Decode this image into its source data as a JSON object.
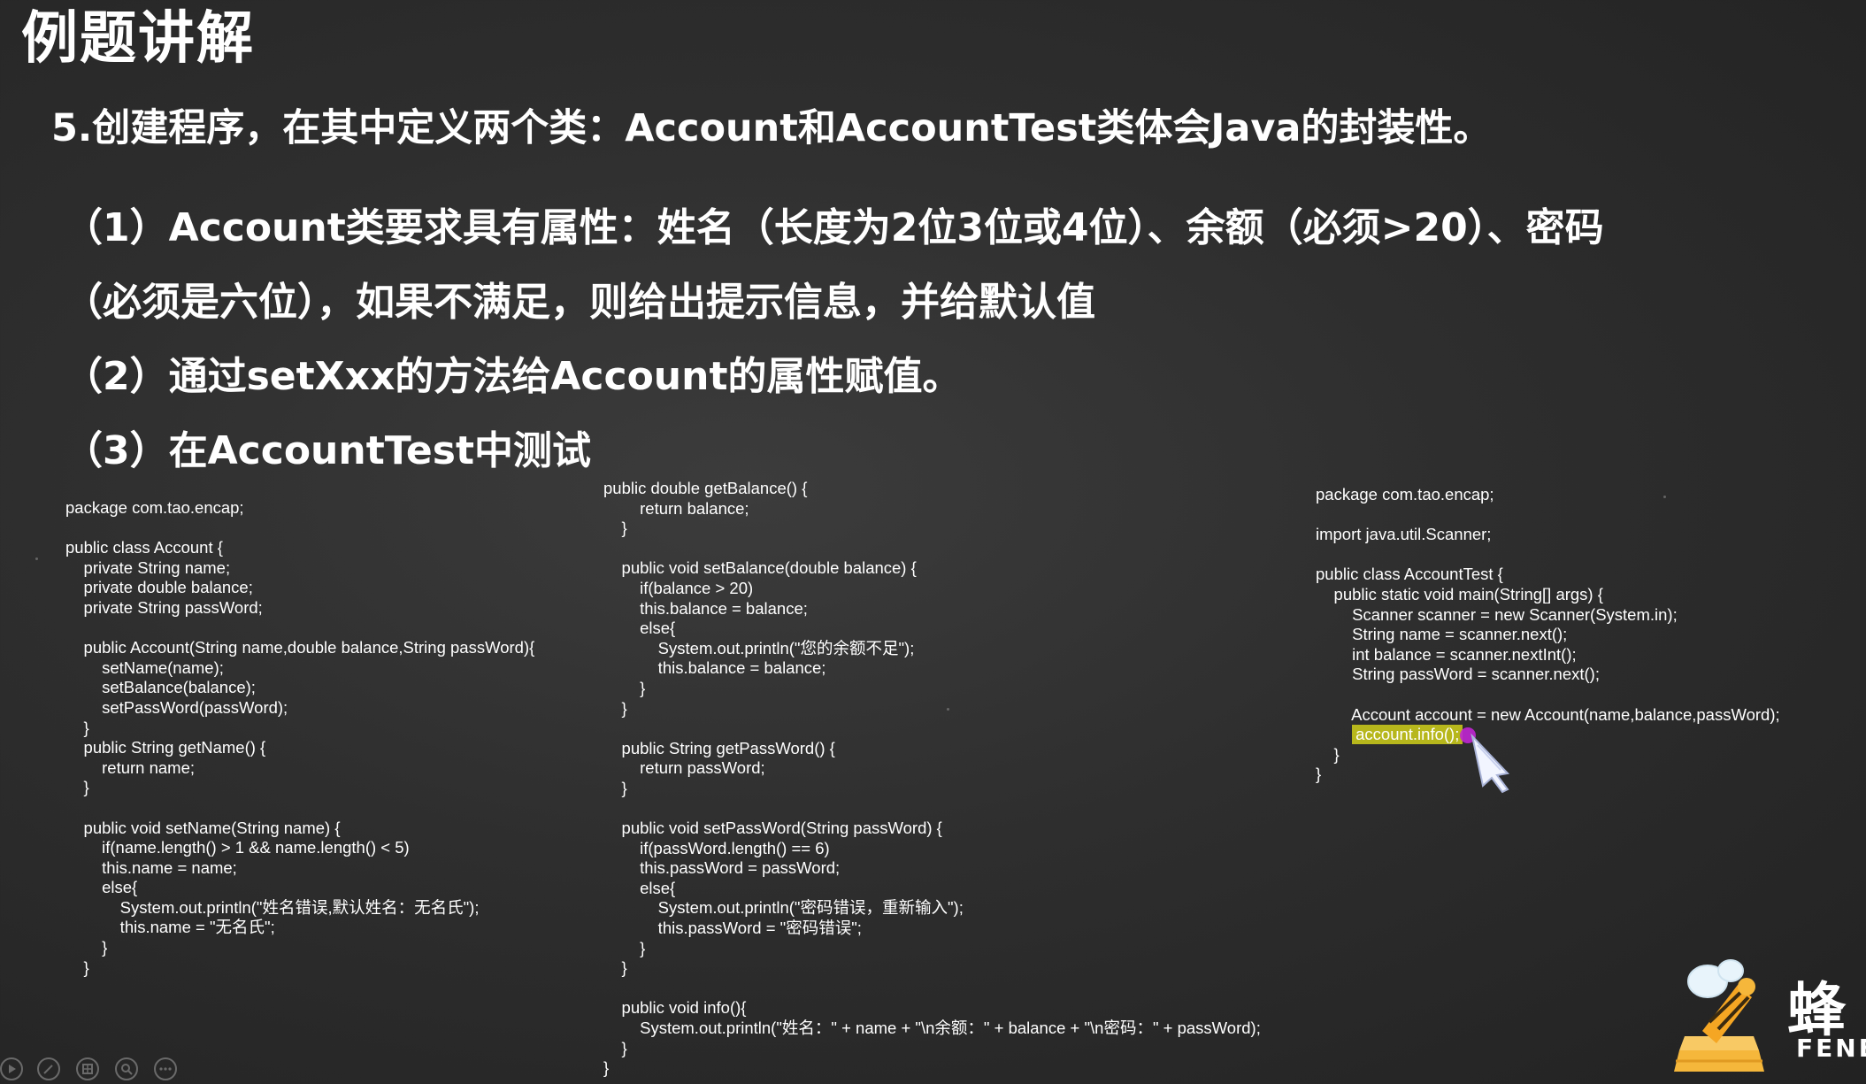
{
  "slide": {
    "title": "例题讲解",
    "question": "5.创建程序，在其中定义两个类：Account和AccountTest类体会Java的封装性。",
    "requirements": [
      "（1）Account类要求具有属性：姓名（长度为2位3位或4位）、余额（必须>20）、密码",
      "（必须是六位），如果不满足，则给出提示信息，并给默认值",
      "（2）通过setXxx的方法给Account的属性赋值。",
      "（3）在AccountTest中测试"
    ]
  },
  "code": {
    "left": [
      "package com.tao.encap;",
      "",
      "public class Account {",
      "    private String name;",
      "    private double balance;",
      "    private String passWord;",
      "",
      "    public Account(String name,double balance,String passWord){",
      "        setName(name);",
      "        setBalance(balance);",
      "        setPassWord(passWord);",
      "    }",
      "    public String getName() {",
      "        return name;",
      "    }",
      "",
      "    public void setName(String name) {",
      "        if(name.length() > 1 && name.length() < 5)",
      "        this.name = name;",
      "        else{",
      "            System.out.println(\"姓名错误,默认姓名：无名氏\");",
      "            this.name = \"无名氏\";",
      "        }",
      "    }"
    ],
    "middle": [
      "public double getBalance() {",
      "        return balance;",
      "    }",
      "",
      "    public void setBalance(double balance) {",
      "        if(balance > 20)",
      "        this.balance = balance;",
      "        else{",
      "            System.out.println(\"您的余额不足\");",
      "            this.balance = balance;",
      "        }",
      "    }",
      "",
      "    public String getPassWord() {",
      "        return passWord;",
      "    }",
      "",
      "    public void setPassWord(String passWord) {",
      "        if(passWord.length() == 6)",
      "        this.passWord = passWord;",
      "        else{",
      "            System.out.println(\"密码错误，重新输入\");",
      "            this.passWord = \"密码错误\";",
      "        }",
      "    }",
      "",
      "    public void info(){",
      "        System.out.println(\"姓名：\" + name + \"\\n余额：\" + balance + \"\\n密码：\" + passWord);",
      "    }",
      "}"
    ],
    "right": [
      "package com.tao.encap;",
      "",
      "import java.util.Scanner;",
      "",
      "public class AccountTest {",
      "    public static void main(String[] args) {",
      "        Scanner scanner = new Scanner(System.in);",
      "        String name = scanner.next();",
      "        int balance = scanner.nextInt();",
      "        String passWord = scanner.next();",
      "",
      "        Account account = new Account(name,balance,passWord);"
    ],
    "right_highlight_indent": "        ",
    "right_highlight": "account.info();",
    "right_tail": [
      "    }",
      "}"
    ],
    "highlight_color": "#b7b71c"
  },
  "toolbar": {
    "buttons": [
      "play-icon",
      "pen-icon",
      "grid-icon",
      "zoom-icon",
      "more-icon"
    ]
  },
  "logo": {
    "cn": "蜂",
    "en": "FENE"
  },
  "colors": {
    "background": "#2e2e2e",
    "text": "#ffffff",
    "cursor_dot": "#c026d3"
  }
}
